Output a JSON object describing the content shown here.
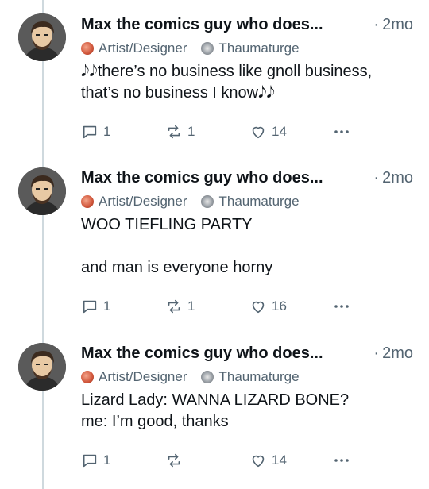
{
  "posts": [
    {
      "author": "Max the comics guy who does...",
      "time_sep": "·",
      "time": "2mo",
      "badges": [
        {
          "label": "Artist/Designer",
          "icon": "artist-badge-icon"
        },
        {
          "label": "Thaumaturge",
          "icon": "thaumaturge-badge-icon"
        }
      ],
      "text": [
        "𝅘𝅥𝅮𝅘𝅥𝅮there’s no business like gnoll business, that’s no business I know𝅘𝅥𝅮𝅘𝅥𝅮"
      ],
      "replies": "1",
      "reposts": "1",
      "likes": "14"
    },
    {
      "author": "Max the comics guy who does...",
      "time_sep": "·",
      "time": "2mo",
      "badges": [
        {
          "label": "Artist/Designer",
          "icon": "artist-badge-icon"
        },
        {
          "label": "Thaumaturge",
          "icon": "thaumaturge-badge-icon"
        }
      ],
      "text": [
        "WOO TIEFLING PARTY",
        "",
        "and man is everyone horny"
      ],
      "replies": "1",
      "reposts": "1",
      "likes": "16"
    },
    {
      "author": "Max the comics guy who does...",
      "time_sep": "·",
      "time": "2mo",
      "badges": [
        {
          "label": "Artist/Designer",
          "icon": "artist-badge-icon"
        },
        {
          "label": "Thaumaturge",
          "icon": "thaumaturge-badge-icon"
        }
      ],
      "text": [
        "Lizard Lady: WANNA LIZARD BONE?",
        "me: I’m good, thanks"
      ],
      "replies": "1",
      "reposts": "",
      "likes": "14"
    }
  ],
  "icons": {
    "reply": "reply-bubble-icon",
    "repost": "repost-arrows-icon",
    "like": "heart-icon",
    "more": "more-dots-icon"
  },
  "colors": {
    "text": "#0f1419",
    "muted": "#536471",
    "thread_line": "#cfd9de"
  }
}
